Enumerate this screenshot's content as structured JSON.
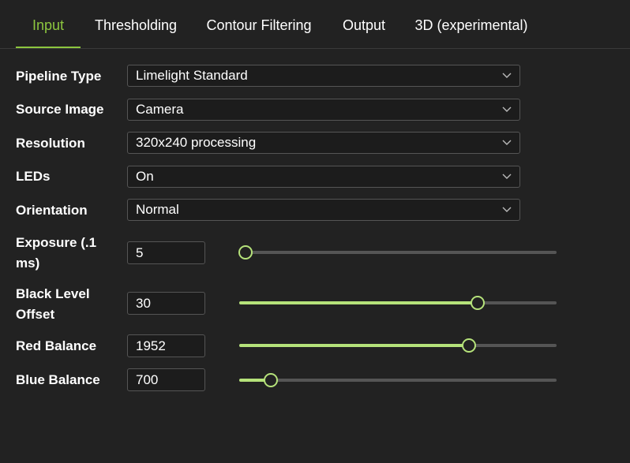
{
  "tabs": [
    {
      "label": "Input",
      "active": true
    },
    {
      "label": "Thresholding",
      "active": false
    },
    {
      "label": "Contour Filtering",
      "active": false
    },
    {
      "label": "Output",
      "active": false
    },
    {
      "label": "3D (experimental)",
      "active": false
    }
  ],
  "colors": {
    "accent": "#8cc63f",
    "slider_fill": "#b5e27a",
    "background": "#222222",
    "field_background": "#1c1c1c"
  },
  "selects": {
    "pipeline_type": {
      "label": "Pipeline Type",
      "value": "Limelight Standard",
      "icon": "chevron-down-icon"
    },
    "source_image": {
      "label": "Source Image",
      "value": "Camera",
      "icon": "chevron-down-icon"
    },
    "resolution": {
      "label": "Resolution",
      "value": "320x240 processing",
      "icon": "chevron-down-icon"
    },
    "leds": {
      "label": "LEDs",
      "value": "On",
      "icon": "chevron-down-icon"
    },
    "orientation": {
      "label": "Orientation",
      "value": "Normal",
      "icon": "chevron-down-icon"
    }
  },
  "sliders": {
    "exposure": {
      "label_line1": "Exposure (.1",
      "label_line2": "ms)",
      "value": "5",
      "fraction": 0.02
    },
    "black_level": {
      "label_line1": "Black Level",
      "label_line2": "Offset",
      "value": "30",
      "fraction": 0.75
    },
    "red_balance": {
      "label": "Red Balance",
      "value": "1952",
      "fraction": 0.725
    },
    "blue_balance": {
      "label": "Blue Balance",
      "value": "700",
      "fraction": 0.1
    }
  }
}
